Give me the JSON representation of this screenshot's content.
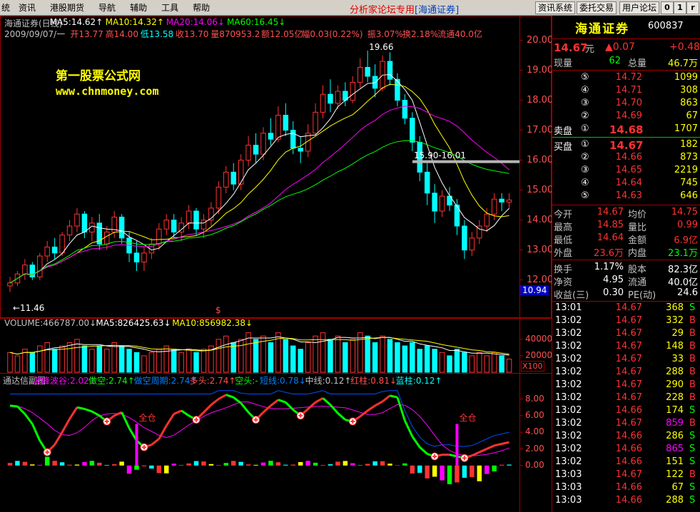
{
  "menu": {
    "system_icon": "统",
    "items": [
      "资讯",
      "港股期货",
      "导航",
      "辅助",
      "工具",
      "帮助"
    ],
    "center_text": "分析家论坛专用",
    "center_brand": "[海通证券]",
    "buttons": [
      "资讯系统",
      "委托交易",
      "用户论坛"
    ],
    "window_controls": [
      "0",
      "1",
      "r"
    ]
  },
  "header": {
    "line1": [
      {
        "text": "海通证券(日线)",
        "color": "#c0c0c0"
      },
      {
        "text": "MA5:14.62↑",
        "color": "#ffffff"
      },
      {
        "text": "MA10:14.32↑",
        "color": "#ffff00"
      },
      {
        "text": "MA20:14.06↓",
        "color": "#ff00ff"
      },
      {
        "text": "MA60:16.45↓",
        "color": "#00ff00"
      }
    ],
    "line2": [
      {
        "text": "2009/09/07/一",
        "color": "#c0c0c0"
      },
      {
        "text": "开13.77",
        "color": "#ff5050"
      },
      {
        "text": "高14.00",
        "color": "#ff5050"
      },
      {
        "text": "低13.58",
        "color": "#00ffff"
      },
      {
        "text": "收13.70",
        "color": "#ff5050"
      },
      {
        "text": "量870953.2",
        "color": "#ff5050"
      },
      {
        "text": "额12.05亿",
        "color": "#ff5050"
      },
      {
        "text": "幅0.03(0.22%)",
        "color": "#ff5050"
      },
      {
        "text": "振3.07%",
        "color": "#ff5050"
      },
      {
        "text": "换2.18%",
        "color": "#ff5050"
      },
      {
        "text": "流通40.0亿",
        "color": "#ff5050"
      }
    ]
  },
  "watermark": {
    "title": "第一股票公式网",
    "url": "www.chnmoney.com"
  },
  "price_axis": [
    "20.00",
    "19.00",
    "18.00",
    "17.00",
    "16.00",
    "15.00",
    "14.00",
    "13.00",
    "12.00"
  ],
  "annotations": {
    "high": "19.66",
    "low": "←11.46",
    "band": "15.90-16.01",
    "current_price_box": "10.94",
    "marker": "$"
  },
  "volume_header": [
    {
      "text": "VOLUME:466787.00↓",
      "color": "#c0c0c0"
    },
    {
      "text": "MA5:826425.63↓",
      "color": "#ffffff"
    },
    {
      "text": "MA10:856982.38↓",
      "color": "#ffff00"
    }
  ],
  "volume_axis": [
    "40000",
    "20000"
  ],
  "volume_unit": "X100",
  "indicator_header": [
    {
      "text": "通达信副图",
      "color": "#c0c0c0"
    },
    {
      "text": "波峰波谷:2.02↑",
      "color": "#ff00ff"
    },
    {
      "text": "做空:2.74↑",
      "color": "#00ff00"
    },
    {
      "text": "做空周期:2.74↑",
      "color": "#0080ff"
    },
    {
      "text": "多头:2.74↑",
      "color": "#ff5050"
    },
    {
      "text": "空头:-",
      "color": "#00ff00"
    },
    {
      "text": "短线:0.78↓",
      "color": "#0080ff"
    },
    {
      "text": "中线:0.12↑",
      "color": "#c0c0c0"
    },
    {
      "text": "红柱:0.81↓",
      "color": "#ff5050"
    },
    {
      "text": "蓝柱:0.12↑",
      "color": "#00ffff"
    }
  ],
  "indicator_axis": [
    "8.00",
    "6.00",
    "4.00",
    "2.00",
    "0.00"
  ],
  "indicator_labels": [
    "全仓",
    "全仓"
  ],
  "chart_data": {
    "type": "candlestick",
    "y_range": [
      11.3,
      20.3
    ],
    "ohlc": [
      [
        11.8,
        12.1,
        11.6,
        11.9
      ],
      [
        11.9,
        12.3,
        11.8,
        12.2
      ],
      [
        12.2,
        12.7,
        12.0,
        12.5
      ],
      [
        12.5,
        12.6,
        12.0,
        12.1
      ],
      [
        12.1,
        12.9,
        12.0,
        12.8
      ],
      [
        12.8,
        13.3,
        12.6,
        13.1
      ],
      [
        13.1,
        13.4,
        12.7,
        12.9
      ],
      [
        12.9,
        13.6,
        12.8,
        13.5
      ],
      [
        13.5,
        14.0,
        13.3,
        13.8
      ],
      [
        13.8,
        14.4,
        13.6,
        14.2
      ],
      [
        14.2,
        14.3,
        13.4,
        13.6
      ],
      [
        13.6,
        14.1,
        13.3,
        13.9
      ],
      [
        13.9,
        14.2,
        13.0,
        13.2
      ],
      [
        13.2,
        13.8,
        13.0,
        13.6
      ],
      [
        13.6,
        14.3,
        13.4,
        14.1
      ],
      [
        14.1,
        14.2,
        13.2,
        13.4
      ],
      [
        13.4,
        13.6,
        12.6,
        12.9
      ],
      [
        12.9,
        13.3,
        12.3,
        12.6
      ],
      [
        12.6,
        13.1,
        12.3,
        12.9
      ],
      [
        12.9,
        13.4,
        12.7,
        13.2
      ],
      [
        13.2,
        13.9,
        13.0,
        13.7
      ],
      [
        13.7,
        14.2,
        13.5,
        14.0
      ],
      [
        14.0,
        14.2,
        13.4,
        13.6
      ],
      [
        13.6,
        14.1,
        13.3,
        13.9
      ],
      [
        13.9,
        14.5,
        13.7,
        14.3
      ],
      [
        14.3,
        14.4,
        13.5,
        13.7
      ],
      [
        13.7,
        14.2,
        13.4,
        14.0
      ],
      [
        14.0,
        14.6,
        13.8,
        14.4
      ],
      [
        14.4,
        15.3,
        14.2,
        15.1
      ],
      [
        15.1,
        15.8,
        14.9,
        15.6
      ],
      [
        15.6,
        15.9,
        15.0,
        15.2
      ],
      [
        15.2,
        16.2,
        15.0,
        16.0
      ],
      [
        16.0,
        16.8,
        15.8,
        16.5
      ],
      [
        16.5,
        16.9,
        15.9,
        16.2
      ],
      [
        16.2,
        17.1,
        16.0,
        16.9
      ],
      [
        16.9,
        17.4,
        16.5,
        16.7
      ],
      [
        16.7,
        17.8,
        16.6,
        17.5
      ],
      [
        17.5,
        17.9,
        16.8,
        17.0
      ],
      [
        17.0,
        17.3,
        16.2,
        16.4
      ],
      [
        16.4,
        16.8,
        15.9,
        16.3
      ],
      [
        16.3,
        17.2,
        16.1,
        16.9
      ],
      [
        16.9,
        17.9,
        16.8,
        17.6
      ],
      [
        17.6,
        18.5,
        17.4,
        18.2
      ],
      [
        18.2,
        18.7,
        17.6,
        17.9
      ],
      [
        17.9,
        18.5,
        17.7,
        18.3
      ],
      [
        18.3,
        18.6,
        17.8,
        18.0
      ],
      [
        18.0,
        18.8,
        17.9,
        18.6
      ],
      [
        18.6,
        19.4,
        18.4,
        19.1
      ],
      [
        19.1,
        19.66,
        18.6,
        18.8
      ],
      [
        18.8,
        19.2,
        18.1,
        18.4
      ],
      [
        18.4,
        19.5,
        18.3,
        19.3
      ],
      [
        19.3,
        19.6,
        18.5,
        18.7
      ],
      [
        18.7,
        18.9,
        17.8,
        18.0
      ],
      [
        18.0,
        18.2,
        17.2,
        17.4
      ],
      [
        17.4,
        17.6,
        16.3,
        16.6
      ],
      [
        16.6,
        16.8,
        15.3,
        15.6
      ],
      [
        15.6,
        15.9,
        14.5,
        14.9
      ],
      [
        14.9,
        15.2,
        13.9,
        14.3
      ],
      [
        14.3,
        15.0,
        14.1,
        14.8
      ],
      [
        14.8,
        15.1,
        14.3,
        14.5
      ],
      [
        14.5,
        14.7,
        13.5,
        13.8
      ],
      [
        13.8,
        14.0,
        12.7,
        13.0
      ],
      [
        13.0,
        13.6,
        12.8,
        13.4
      ],
      [
        13.4,
        14.0,
        13.2,
        13.8
      ],
      [
        13.8,
        14.4,
        13.6,
        14.2
      ],
      [
        14.2,
        14.9,
        14.0,
        14.7
      ],
      [
        14.7,
        14.9,
        14.3,
        14.6
      ],
      [
        14.6,
        14.9,
        14.4,
        14.67
      ]
    ],
    "volume": [
      0.6,
      0.5,
      0.7,
      0.6,
      0.8,
      0.9,
      0.7,
      0.8,
      0.9,
      1.0,
      0.8,
      0.7,
      0.8,
      0.7,
      0.9,
      0.8,
      0.7,
      0.6,
      0.5,
      0.6,
      0.7,
      0.8,
      0.7,
      0.6,
      0.7,
      0.6,
      0.7,
      0.8,
      1.0,
      1.1,
      0.9,
      1.0,
      1.2,
      1.0,
      1.1,
      0.9,
      1.2,
      1.0,
      0.8,
      0.7,
      0.9,
      1.1,
      1.2,
      1.0,
      1.1,
      0.9,
      1.0,
      1.2,
      1.1,
      0.9,
      1.1,
      1.0,
      0.9,
      0.8,
      0.9,
      0.7,
      0.8,
      0.7,
      0.6,
      0.5,
      0.7,
      0.6,
      0.5,
      0.6,
      0.5,
      0.6,
      0.5,
      0.4
    ],
    "indicator": [
      7.2,
      7.1,
      6.2,
      5.0,
      3.0,
      1.6,
      2.5,
      4.0,
      5.6,
      7.0,
      6.8,
      6.5,
      6.0,
      5.3,
      6.0,
      6.4,
      4.5,
      3.0,
      2.2,
      2.5,
      3.2,
      4.8,
      6.2,
      6.6,
      6.0,
      5.5,
      6.4,
      7.3,
      8.0,
      8.5,
      8.2,
      7.5,
      6.4,
      5.5,
      6.4,
      7.2,
      7.9,
      7.6,
      6.7,
      6.0,
      6.8,
      7.6,
      8.1,
      7.3,
      6.3,
      5.5,
      5.3,
      5.9,
      6.6,
      7.2,
      7.7,
      8.4,
      8.2,
      5.4,
      3.5,
      2.2,
      1.4,
      1.1,
      1.3,
      1.3,
      1.1,
      0.9,
      1.2,
      1.6,
      2.0,
      2.4,
      2.6,
      2.8
    ]
  },
  "quote": {
    "name": "海通证券",
    "code": "600837",
    "price": "14.67",
    "price_unit": "元",
    "change": "▲0.07",
    "change_pct": "+0.48",
    "rows": [
      {
        "a": "现量",
        "b": "62",
        "c": "总量",
        "d": "46.7万"
      }
    ],
    "sell_label": "卖盘",
    "sells": [
      {
        "lv": "⑤",
        "p": "14.72",
        "v": "1099"
      },
      {
        "lv": "④",
        "p": "14.71",
        "v": "308"
      },
      {
        "lv": "③",
        "p": "14.70",
        "v": "863"
      },
      {
        "lv": "②",
        "p": "14.69",
        "v": "67"
      },
      {
        "lv": "①",
        "p": "14.68",
        "v": "1707"
      }
    ],
    "buy_label": "买盘",
    "buys": [
      {
        "lv": "①",
        "p": "14.67",
        "v": "182"
      },
      {
        "lv": "②",
        "p": "14.66",
        "v": "873"
      },
      {
        "lv": "③",
        "p": "14.65",
        "v": "2219"
      },
      {
        "lv": "④",
        "p": "14.64",
        "v": "745"
      },
      {
        "lv": "⑤",
        "p": "14.63",
        "v": "646"
      }
    ],
    "stats": [
      {
        "a": "今开",
        "b": "14.67",
        "c": "均价",
        "d": "14.75"
      },
      {
        "a": "最高",
        "b": "14.85",
        "c": "量比",
        "d": "0.99"
      },
      {
        "a": "最低",
        "b": "14.64",
        "c": "金额",
        "d": "6.9亿"
      },
      {
        "a": "外盘",
        "b": "23.6万",
        "c": "内盘",
        "d": "23.1万"
      }
    ],
    "stats2": [
      {
        "a": "换手",
        "b": "1.17%",
        "c": "股本",
        "d": "82.3亿"
      },
      {
        "a": "净资",
        "b": "4.95",
        "c": "流通",
        "d": "40.0亿"
      },
      {
        "a": "收益(三)",
        "b": "0.30",
        "c": "PE(动)",
        "d": "24.6"
      }
    ],
    "ticks": [
      {
        "t": "13:01",
        "p": "14.67",
        "v": "368",
        "s": "S"
      },
      {
        "t": "13:02",
        "p": "14.67",
        "v": "332",
        "s": "B"
      },
      {
        "t": "13:02",
        "p": "14.67",
        "v": "29",
        "s": "B"
      },
      {
        "t": "13:02",
        "p": "14.67",
        "v": "148",
        "s": "B"
      },
      {
        "t": "13:02",
        "p": "14.67",
        "v": "33",
        "s": "B"
      },
      {
        "t": "13:02",
        "p": "14.67",
        "v": "288",
        "s": "B"
      },
      {
        "t": "13:02",
        "p": "14.67",
        "v": "290",
        "s": "B"
      },
      {
        "t": "13:02",
        "p": "14.67",
        "v": "228",
        "s": "B"
      },
      {
        "t": "13:02",
        "p": "14.66",
        "v": "174",
        "s": "S"
      },
      {
        "t": "13:02",
        "p": "14.67",
        "v": "859",
        "s": "B"
      },
      {
        "t": "13:02",
        "p": "14.66",
        "v": "286",
        "s": "S"
      },
      {
        "t": "13:02",
        "p": "14.66",
        "v": "865",
        "s": "S"
      },
      {
        "t": "13:02",
        "p": "14.66",
        "v": "151",
        "s": "S"
      },
      {
        "t": "13:03",
        "p": "14.67",
        "v": "122",
        "s": "B"
      },
      {
        "t": "13:03",
        "p": "14.66",
        "v": "67",
        "s": "S"
      },
      {
        "t": "13:03",
        "p": "14.66",
        "v": "288",
        "s": "S"
      }
    ]
  },
  "colors": {
    "up": "#ff3232",
    "down": "#00ffff",
    "ma5": "#ffffff",
    "ma10": "#ffff00",
    "ma20": "#ff00ff",
    "ma60": "#00ff00",
    "axis": "#a00000"
  }
}
